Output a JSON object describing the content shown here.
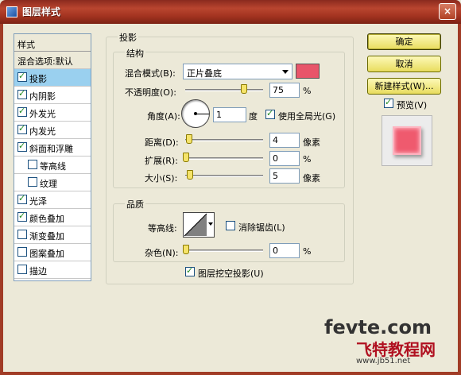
{
  "window": {
    "title": "图层样式",
    "close_label": "×"
  },
  "sidebar": {
    "header": "样式",
    "blend_default": "混合选项:默认",
    "items": [
      {
        "label": "投影",
        "checked": true,
        "selected": true
      },
      {
        "label": "内阴影",
        "checked": true
      },
      {
        "label": "外发光",
        "checked": true
      },
      {
        "label": "内发光",
        "checked": true
      },
      {
        "label": "斜面和浮雕",
        "checked": true
      },
      {
        "label": "等高线",
        "checked": false,
        "sub": true
      },
      {
        "label": "纹理",
        "checked": false,
        "sub": true
      },
      {
        "label": "光泽",
        "checked": true
      },
      {
        "label": "颜色叠加",
        "checked": true
      },
      {
        "label": "渐变叠加",
        "checked": false
      },
      {
        "label": "图案叠加",
        "checked": false
      },
      {
        "label": "描边",
        "checked": false
      }
    ]
  },
  "shadow": {
    "group_title": "投影",
    "structure_title": "结构",
    "blend_mode_label": "混合模式(B):",
    "blend_mode_value": "正片叠底",
    "blend_color": "#e8556a",
    "opacity_label": "不透明度(O):",
    "opacity_value": "75",
    "opacity_unit": "%",
    "angle_label": "角度(A):",
    "angle_value": "1",
    "angle_unit": "度",
    "global_light_label": "使用全局光(G)",
    "global_light_checked": true,
    "distance_label": "距离(D):",
    "distance_value": "4",
    "distance_unit": "像素",
    "spread_label": "扩展(R):",
    "spread_value": "0",
    "spread_unit": "%",
    "size_label": "大小(S):",
    "size_value": "5",
    "size_unit": "像素",
    "quality_title": "品质",
    "contour_label": "等高线:",
    "antialias_label": "消除锯齿(L)",
    "antialias_checked": false,
    "noise_label": "杂色(N):",
    "noise_value": "0",
    "noise_unit": "%",
    "knockout_label": "图层挖空投影(U)",
    "knockout_checked": true
  },
  "buttons": {
    "ok": "确定",
    "cancel": "取消",
    "new_style": "新建样式(W)...",
    "preview_label": "预览(V)",
    "preview_checked": true
  },
  "watermark": {
    "line1": "fevte.com",
    "line2": "飞特教程网",
    "line3": "www.jb51.net"
  }
}
